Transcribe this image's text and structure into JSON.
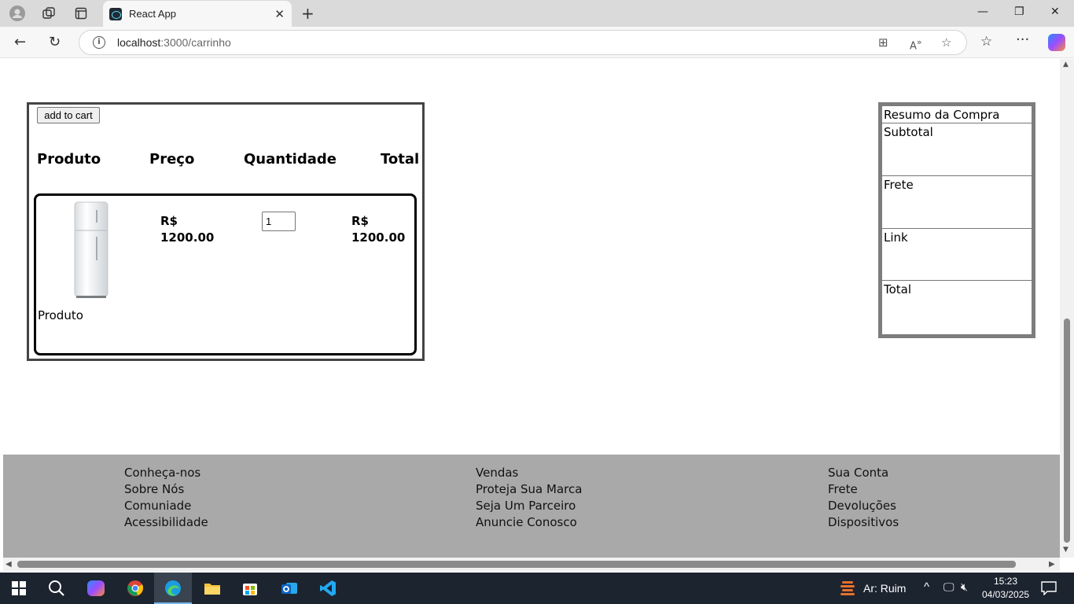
{
  "browser": {
    "tab_title": "React App",
    "url_host": "localhost",
    "url_path": ":3000/carrinho"
  },
  "cart": {
    "add_button": "add to cart",
    "headers": [
      "Produto",
      "Preço",
      "Quantidade",
      "Total"
    ],
    "item": {
      "name": "Produto",
      "price_currency": "R$",
      "price_value": "1200.00",
      "quantity": "1",
      "total_currency": "R$",
      "total_value": "1200.00"
    }
  },
  "summary": {
    "title": "Resumo da Compra",
    "rows": [
      "Subtotal",
      "Frete",
      "Link",
      "Total"
    ]
  },
  "footer": {
    "col1": [
      "Conheça-nos",
      "Sobre Nós",
      "Comuniade",
      "Acessibilidade"
    ],
    "col2": [
      "Vendas",
      "Proteja Sua Marca",
      "Seja Um Parceiro",
      "Anuncie Conosco"
    ],
    "col3": [
      "Sua Conta",
      "Frete",
      "Devoluções",
      "Dispositivos"
    ]
  },
  "taskbar": {
    "weather": "Ar: Ruim",
    "time": "15:23",
    "date": "04/03/2025"
  }
}
